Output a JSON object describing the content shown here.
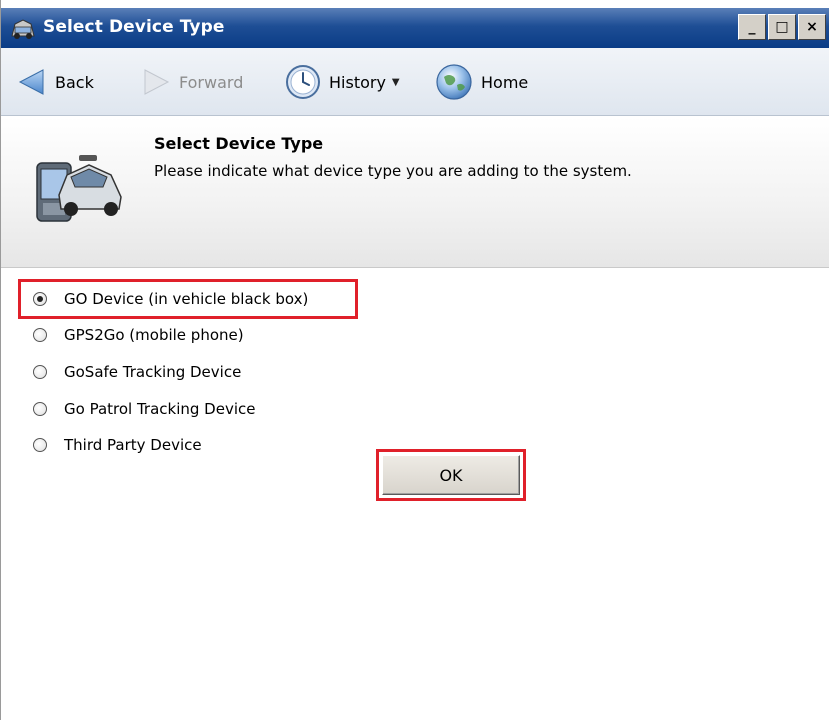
{
  "window": {
    "title": "Select Device Type",
    "controls": [
      "_",
      "□",
      "×"
    ]
  },
  "nav": {
    "back_label": "Back",
    "forward_label": "Forward",
    "history_label": "History",
    "home_label": "Home"
  },
  "header": {
    "title": "Select Device Type",
    "description": "Please indicate what device type you are adding to the system."
  },
  "options": [
    {
      "label": "GO Device (in vehicle black box)",
      "checked": true
    },
    {
      "label": "GPS2Go (mobile phone)",
      "checked": false
    },
    {
      "label": "GoSafe Tracking Device",
      "checked": false
    },
    {
      "label": "Go Patrol Tracking Device",
      "checked": false
    },
    {
      "label": "Third Party Device",
      "checked": false
    }
  ],
  "ok_label": "OK",
  "colors": {
    "titlebar": "#0a3c86",
    "highlight": "#e0202a"
  },
  "icons": {
    "title": "car-app-icon",
    "back": "back-arrow-icon",
    "forward": "forward-arrow-icon",
    "history": "clock-icon",
    "home": "globe-icon",
    "header": "car-phone-icon"
  }
}
